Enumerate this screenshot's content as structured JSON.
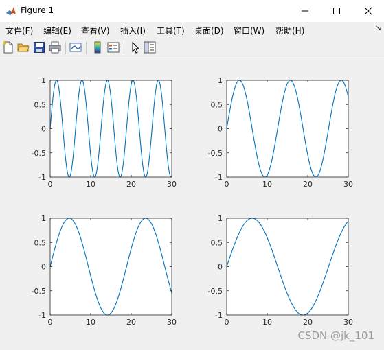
{
  "window": {
    "title": "Figure 1",
    "minimize_icon": "minimize-icon",
    "maximize_icon": "maximize-icon",
    "close_icon": "close-icon"
  },
  "menu": {
    "items": [
      "文件(F)",
      "编辑(E)",
      "查看(V)",
      "插入(I)",
      "工具(T)",
      "桌面(D)",
      "窗口(W)",
      "帮助(H)"
    ]
  },
  "toolbar": {
    "icons": [
      "new-figure-icon",
      "open-file-icon",
      "save-icon",
      "print-icon",
      "link-plot-icon",
      "insert-colorbar-icon",
      "insert-legend-icon",
      "edit-plot-icon",
      "property-inspector-icon"
    ]
  },
  "colors": {
    "line": "#0072bd"
  },
  "watermark": "CSDN @jk_101",
  "chart_data": [
    {
      "type": "line",
      "function": "sin(x)",
      "freq": 1.0,
      "xlim": [
        0,
        30
      ],
      "ylim": [
        -1,
        1
      ],
      "xticks": [
        "0",
        "10",
        "20",
        "30"
      ],
      "yticks": [
        "-1",
        "-0.5",
        "0",
        "0.5",
        "1"
      ]
    },
    {
      "type": "line",
      "function": "sin(x/2)",
      "freq": 0.5,
      "xlim": [
        0,
        30
      ],
      "ylim": [
        -1,
        1
      ],
      "xticks": [
        "0",
        "10",
        "20",
        "30"
      ],
      "yticks": [
        "-1",
        "-0.5",
        "0",
        "0.5",
        "1"
      ]
    },
    {
      "type": "line",
      "function": "sin(x/3)",
      "freq": 0.3333,
      "xlim": [
        0,
        30
      ],
      "ylim": [
        -1,
        1
      ],
      "xticks": [
        "0",
        "10",
        "20",
        "30"
      ],
      "yticks": [
        "-1",
        "-0.5",
        "0",
        "0.5",
        "1"
      ]
    },
    {
      "type": "line",
      "function": "sin(x/4)",
      "freq": 0.25,
      "xlim": [
        0,
        30
      ],
      "ylim": [
        -1,
        1
      ],
      "xticks": [
        "0",
        "10",
        "20",
        "30"
      ],
      "yticks": [
        "-1",
        "-0.5",
        "0",
        "0.5",
        "1"
      ]
    }
  ]
}
